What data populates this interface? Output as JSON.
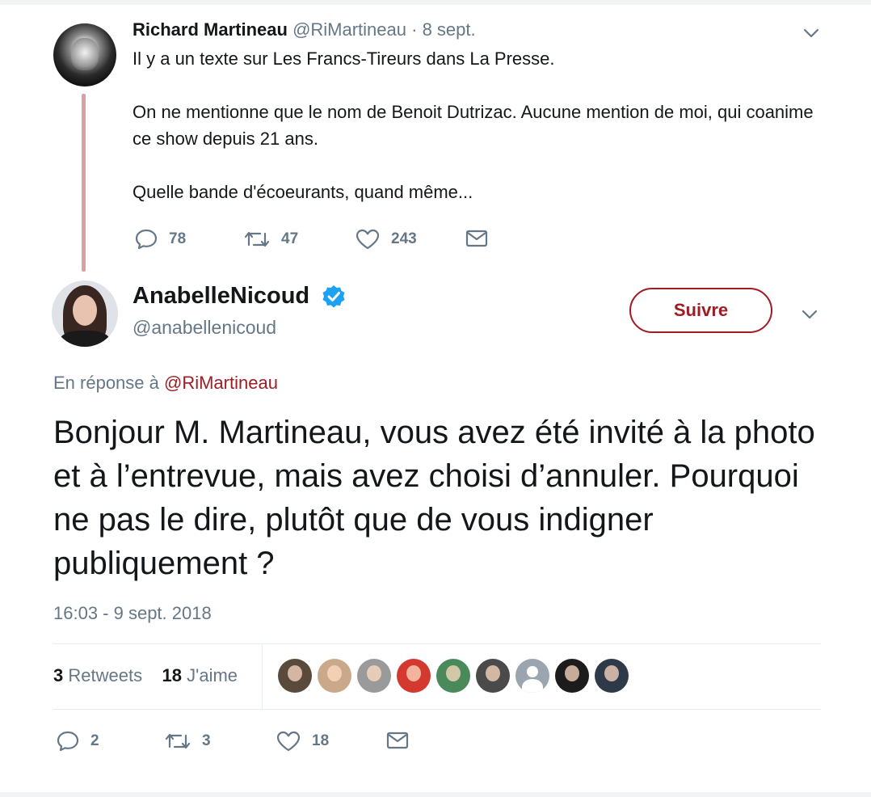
{
  "parent_tweet": {
    "author_name": "Richard Martineau",
    "handle": "@RiMartineau",
    "date": "· 8 sept.",
    "lines": [
      "Il y a un texte sur Les Francs-Tireurs dans La Presse.",
      "On ne mentionne que le nom de Benoit Dutrizac. Aucune mention de moi, qui coanime ce show depuis 21 ans.",
      "Quelle bande d'écoeurants, quand même..."
    ],
    "replies": "78",
    "retweets": "47",
    "likes": "243"
  },
  "main_tweet": {
    "author_name": "AnabelleNicoud",
    "handle": "@anabellenicoud",
    "follow_label": "Suivre",
    "reply_prefix": "En réponse à",
    "reply_mention": "@RiMartineau",
    "text": "Bonjour M. Martineau, vous avez été invité à la photo et à l’entrevue, mais avez choisi d’annuler. Pourquoi ne pas le dire, plutôt que de vous indigner publiquement ?",
    "timestamp": "16:03 - 9 sept. 2018",
    "retweet_count": "3",
    "retweet_label": "Retweets",
    "like_count": "18",
    "like_label": "J'aime",
    "liker_avatars": [
      "#5a4a3c",
      "#c9a98a",
      "#9a9a9a",
      "#d4392f",
      "#4a8a5a",
      "#4a4a4a",
      "#9aa5b0",
      "#1c1c1c",
      "#2f3a48"
    ],
    "action_replies": "2",
    "action_retweets": "3",
    "action_likes": "18"
  },
  "colors": {
    "accent": "#a01c24",
    "muted": "#657786",
    "verified": "#1da1f2"
  }
}
